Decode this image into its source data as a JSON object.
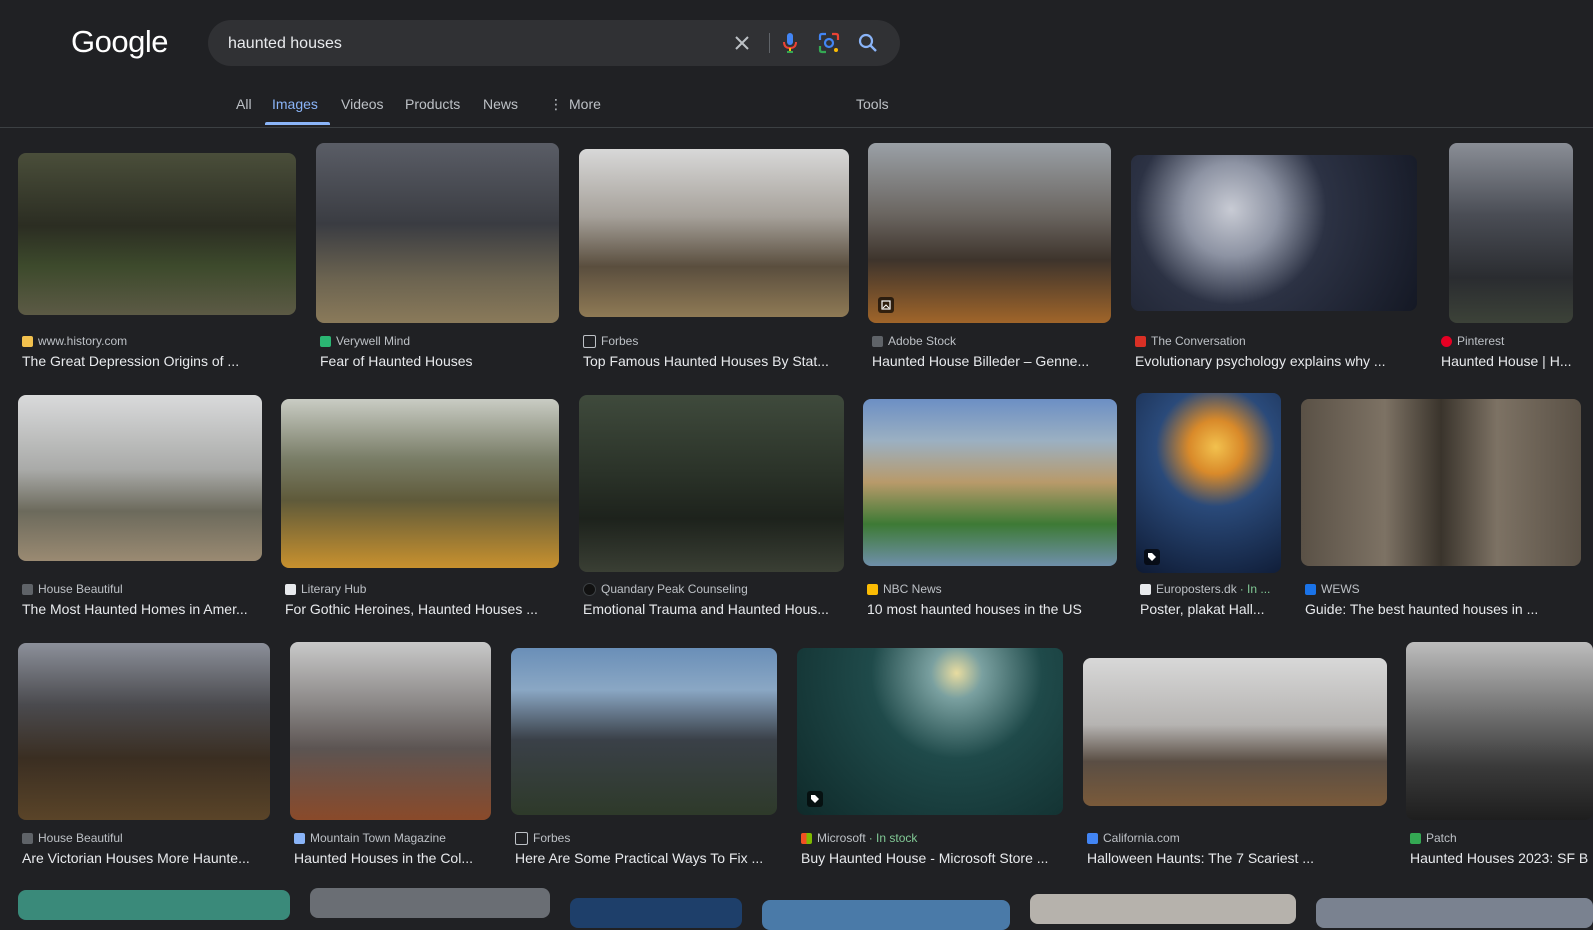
{
  "logo": "Google",
  "search": {
    "query": "haunted houses"
  },
  "tabs": [
    {
      "label": "All"
    },
    {
      "label": "Images"
    },
    {
      "label": "Videos"
    },
    {
      "label": "Products"
    },
    {
      "label": "News"
    },
    {
      "label": "More"
    }
  ],
  "tools_label": "Tools",
  "results": [
    {
      "source": "www.history.com",
      "title": "The Great Depression Origins of ...",
      "favicon_color": "#f2c14e"
    },
    {
      "source": "Verywell Mind",
      "title": "Fear of Haunted Houses",
      "favicon_color": "#2bb673"
    },
    {
      "source": "Forbes",
      "title": "Top Famous Haunted Houses By Stat...",
      "favicon_color": "#202124"
    },
    {
      "source": "Adobe Stock",
      "title": "Haunted House Billeder – Genne...",
      "favicon_color": "#5f6368"
    },
    {
      "source": "The Conversation",
      "title": "Evolutionary psychology explains why ...",
      "favicon_color": "#d93025"
    },
    {
      "source": "Pinterest",
      "title": "Haunted House | H...",
      "favicon_color": "#e60023"
    },
    {
      "source": "House Beautiful",
      "title": "The Most Haunted Homes in Amer...",
      "favicon_color": "#5f6368"
    },
    {
      "source": "Literary Hub",
      "title": "For Gothic Heroines, Haunted Houses ...",
      "favicon_color": "#e8eaed"
    },
    {
      "source": "Quandary Peak Counseling",
      "title": "Emotional Trauma and Haunted Hous...",
      "favicon_color": "#111111"
    },
    {
      "source": "NBC News",
      "title": "10 most haunted houses in the US",
      "favicon_color": "#fbbc04"
    },
    {
      "source": "Europosters.dk",
      "stock": "· In ...",
      "title": "Poster, plakat Hall...",
      "favicon_color": "#e8eaed"
    },
    {
      "source": "WEWS",
      "title": "Guide: The best haunted houses in ...",
      "favicon_color": "#1a73e8"
    },
    {
      "source": "House Beautiful",
      "title": "Are Victorian Houses More Haunte...",
      "favicon_color": "#5f6368"
    },
    {
      "source": "Mountain Town Magazine",
      "title": "Haunted Houses in the Col...",
      "favicon_color": "#8ab4f8"
    },
    {
      "source": "Forbes",
      "title": "Here Are Some Practical Ways To Fix ...",
      "favicon_color": "#202124"
    },
    {
      "source": "Microsoft",
      "stock": "· In stock",
      "title": "Buy Haunted House - Microsoft Store ...",
      "favicon_color": "#f25022"
    },
    {
      "source": "California.com",
      "title": "Halloween Haunts: The 7 Scariest ...",
      "favicon_color": "#4285f4"
    },
    {
      "source": "Patch",
      "title": "Haunted Houses 2023: SF B",
      "favicon_color": "#34a853"
    }
  ],
  "colors": {
    "background": "#202124",
    "accent": "#8ab4f8",
    "in_stock": "#81c995"
  }
}
